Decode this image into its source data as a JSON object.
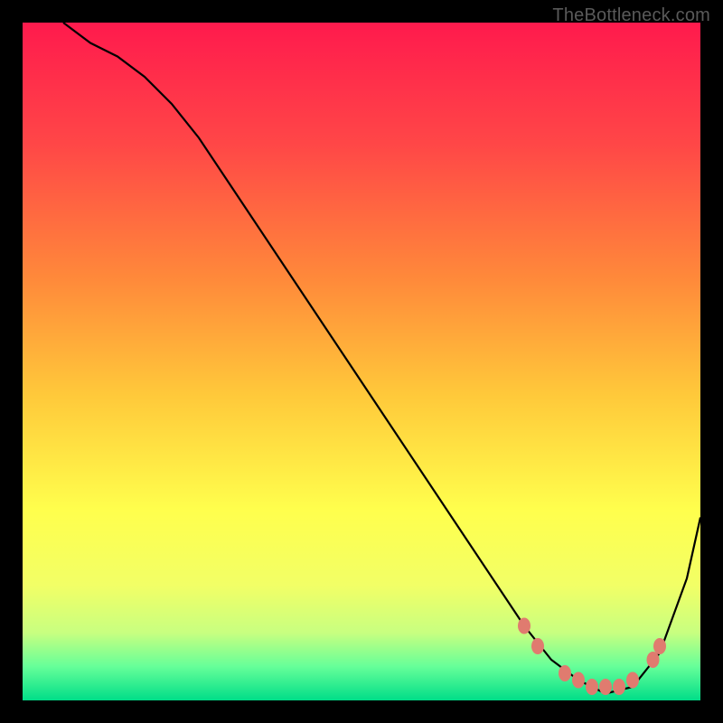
{
  "watermark": "TheBottleneck.com",
  "chart_data": {
    "type": "line",
    "title": "",
    "xlabel": "",
    "ylabel": "",
    "xlim": [
      0,
      100
    ],
    "ylim": [
      0,
      100
    ],
    "gradient_stops": [
      {
        "offset": 0,
        "color": "#ff1a4d"
      },
      {
        "offset": 18,
        "color": "#ff4747"
      },
      {
        "offset": 38,
        "color": "#ff8a3a"
      },
      {
        "offset": 55,
        "color": "#ffc93a"
      },
      {
        "offset": 72,
        "color": "#ffff4d"
      },
      {
        "offset": 83,
        "color": "#f2ff66"
      },
      {
        "offset": 90,
        "color": "#c8ff80"
      },
      {
        "offset": 95,
        "color": "#66ff99"
      },
      {
        "offset": 100,
        "color": "#00dd88"
      }
    ],
    "series": [
      {
        "name": "bottleneck-curve",
        "x": [
          6,
          10,
          14,
          18,
          22,
          26,
          30,
          34,
          38,
          42,
          46,
          50,
          54,
          58,
          62,
          66,
          70,
          74,
          78,
          82,
          86,
          90,
          94,
          98,
          100
        ],
        "y": [
          100,
          97,
          95,
          92,
          88,
          83,
          77,
          71,
          65,
          59,
          53,
          47,
          41,
          35,
          29,
          23,
          17,
          11,
          6,
          3,
          1,
          2,
          7,
          18,
          27
        ]
      }
    ],
    "markers": [
      {
        "x": 74,
        "y": 11
      },
      {
        "x": 76,
        "y": 8
      },
      {
        "x": 80,
        "y": 4
      },
      {
        "x": 82,
        "y": 3
      },
      {
        "x": 84,
        "y": 2
      },
      {
        "x": 86,
        "y": 2
      },
      {
        "x": 88,
        "y": 2
      },
      {
        "x": 90,
        "y": 3
      },
      {
        "x": 93,
        "y": 6
      },
      {
        "x": 94,
        "y": 8
      }
    ]
  }
}
